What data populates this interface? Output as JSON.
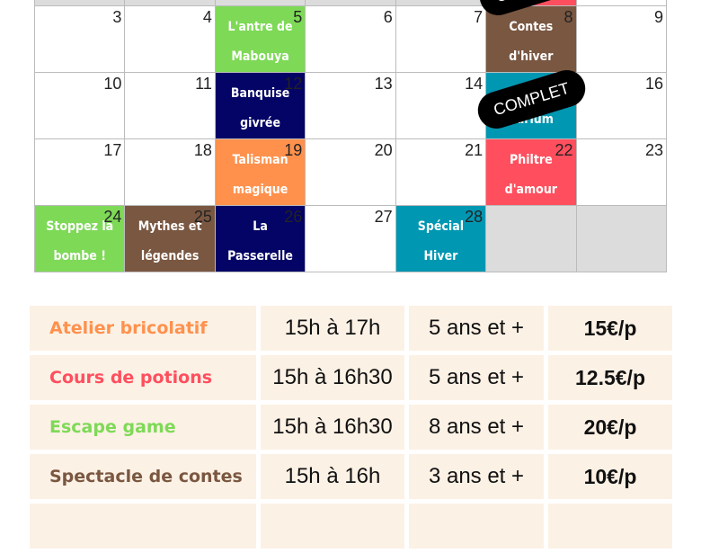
{
  "calendar": {
    "cells": [
      {
        "n": "",
        "empty": true
      },
      {
        "n": "",
        "empty": true
      },
      {
        "n": "",
        "empty": true
      },
      {
        "n": "",
        "empty": true
      },
      {
        "n": "",
        "empty": true
      },
      {
        "n": "",
        "bg": "#ff4f5e"
      },
      {
        "n": ""
      },
      {
        "n": "3"
      },
      {
        "n": "4"
      },
      {
        "n": "5",
        "lines": [
          "L'antre de",
          "Mabouya"
        ],
        "bg": "#7ed957"
      },
      {
        "n": "6"
      },
      {
        "n": "7"
      },
      {
        "n": "8",
        "lines": [
          "Contes",
          "d'hiver"
        ],
        "bg": "#7a5741"
      },
      {
        "n": "9"
      },
      {
        "n": "10"
      },
      {
        "n": "11"
      },
      {
        "n": "12",
        "lines": [
          "Banquise",
          "givrée"
        ],
        "bg": "#040466"
      },
      {
        "n": "13"
      },
      {
        "n": "14"
      },
      {
        "n": "",
        "lines": [
          "",
          "narium"
        ],
        "bg": "#0097b2"
      },
      {
        "n": "16"
      },
      {
        "n": "17"
      },
      {
        "n": "18"
      },
      {
        "n": "19",
        "lines": [
          "Talisman",
          "magique"
        ],
        "bg": "#ff914d"
      },
      {
        "n": "20"
      },
      {
        "n": "21"
      },
      {
        "n": "22",
        "lines": [
          "Philtre",
          "d'amour"
        ],
        "bg": "#ff4f5e"
      },
      {
        "n": "23"
      },
      {
        "n": "24",
        "lines": [
          "Stoppez la",
          "bombe !"
        ],
        "bg": "#7ed957"
      },
      {
        "n": "25",
        "lines": [
          "Mythes et",
          "légendes"
        ],
        "bg": "#7a5741"
      },
      {
        "n": "26",
        "lines": [
          "La",
          "Passerelle"
        ],
        "bg": "#040466"
      },
      {
        "n": "27"
      },
      {
        "n": "28",
        "lines": [
          "Spécial",
          "Hiver"
        ],
        "bg": "#0097b2"
      },
      {
        "n": "",
        "empty": true
      },
      {
        "n": "",
        "empty": true
      }
    ],
    "badge": "COMPLET"
  },
  "activities": [
    {
      "name": "Atelier bricolatif",
      "color": "#ff914d",
      "time": "15h à 17h",
      "age": "5 ans et +",
      "price": "15€/p"
    },
    {
      "name": "Cours de potions",
      "color": "#ff4f5e",
      "time": "15h à 16h30",
      "age": "5 ans et +",
      "price": "12.5€/p"
    },
    {
      "name": "Escape game",
      "color": "#7ed957",
      "time": "15h à 16h30",
      "age": "8 ans et +",
      "price": "20€/p"
    },
    {
      "name": "Spectacle de contes",
      "color": "#7a5741",
      "time": "15h à 16h",
      "age": "3 ans et +",
      "price": "10€/p"
    },
    {
      "name": "",
      "color": "#000",
      "time": "",
      "age": "",
      "price": ""
    }
  ]
}
